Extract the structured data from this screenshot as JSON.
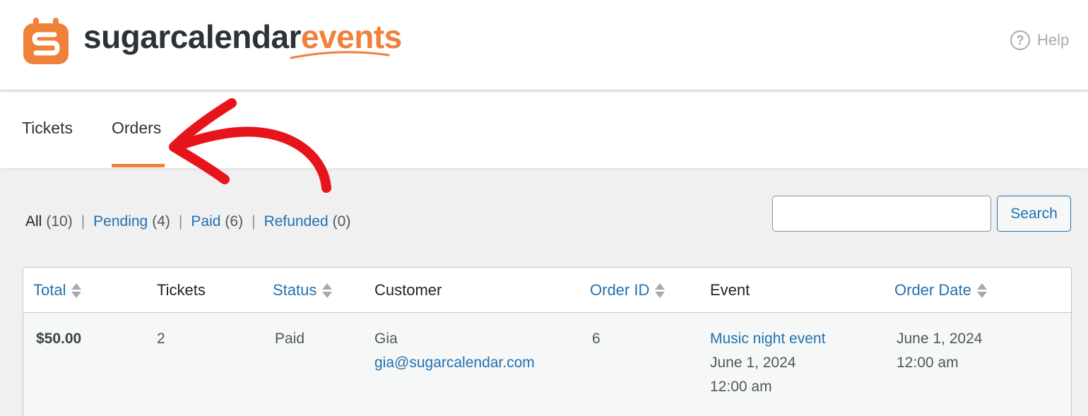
{
  "brand": {
    "word1": "sugarcalendar",
    "word2": "events",
    "colors": {
      "accent": "#f0813a",
      "link": "#2271b1",
      "arrow": "#e8141c"
    }
  },
  "header": {
    "help_label": "Help",
    "help_icon": "question-circle-icon"
  },
  "tabs": [
    {
      "label": "Tickets",
      "active": false
    },
    {
      "label": "Orders",
      "active": true
    }
  ],
  "filters": {
    "all": {
      "label": "All",
      "count": "(10)"
    },
    "pending": {
      "label": "Pending",
      "count": "(4)"
    },
    "paid": {
      "label": "Paid",
      "count": "(6)"
    },
    "refunded": {
      "label": "Refunded",
      "count": "(0)"
    },
    "separator": "|"
  },
  "search": {
    "value": "",
    "placeholder": "",
    "button_label": "Search"
  },
  "table": {
    "columns": [
      {
        "label": "Total",
        "sortable": true
      },
      {
        "label": "Tickets",
        "sortable": false
      },
      {
        "label": "Status",
        "sortable": true
      },
      {
        "label": "Customer",
        "sortable": false
      },
      {
        "label": "Order ID",
        "sortable": true
      },
      {
        "label": "Event",
        "sortable": false
      },
      {
        "label": "Order Date",
        "sortable": true
      }
    ],
    "rows": [
      {
        "total": "$50.00",
        "tickets": "2",
        "status": "Paid",
        "customer_name": "Gia",
        "customer_email": "gia@sugarcalendar.com",
        "order_id": "6",
        "event_name": "Music night event",
        "event_date": "June 1, 2024",
        "event_time": "12:00 am",
        "order_date": "June 1, 2024",
        "order_time": "12:00 am"
      }
    ]
  }
}
